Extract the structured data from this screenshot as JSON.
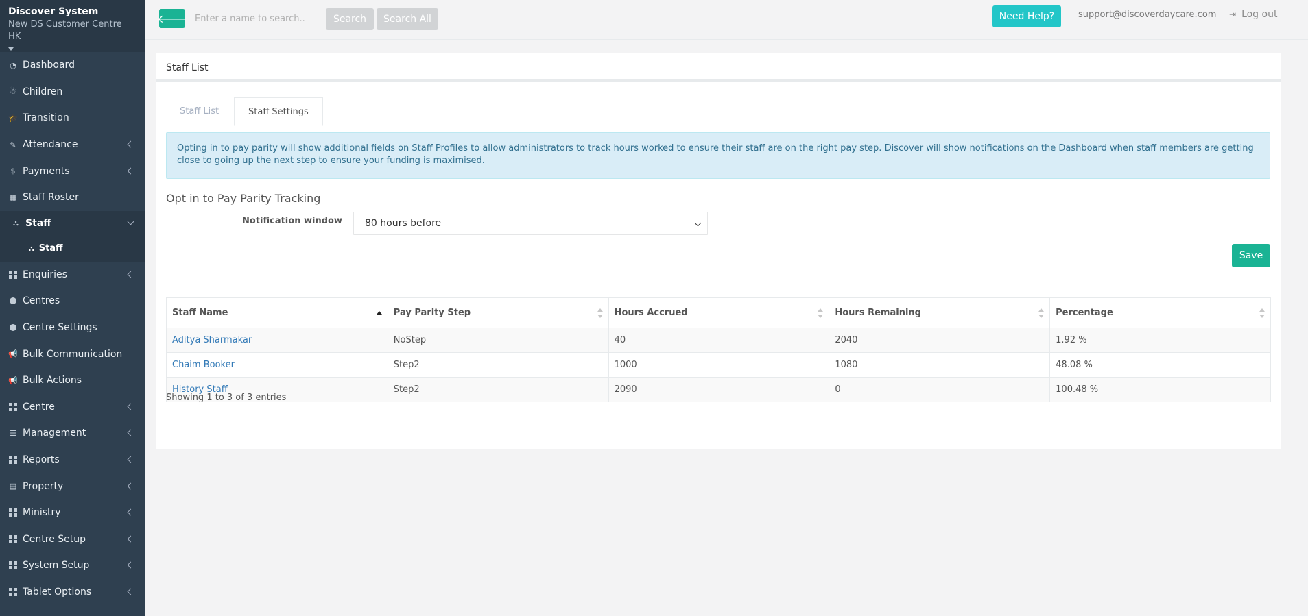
{
  "brand": {
    "title": "Discover System",
    "subtitle": "New DS Customer Centre HK"
  },
  "sidebar": {
    "items": [
      {
        "label": "Dashboard",
        "icon": "pie-chart-icon"
      },
      {
        "label": "Children",
        "icon": "child-icon"
      },
      {
        "label": "Transition",
        "icon": "graduation-cap-icon"
      },
      {
        "label": "Attendance",
        "icon": "edit-icon",
        "has_arrow": true
      },
      {
        "label": "Payments",
        "icon": "dollar-icon",
        "has_arrow": true
      },
      {
        "label": "Staff Roster",
        "icon": "calendar-icon"
      },
      {
        "label": "Staff",
        "icon": "sitemap-icon",
        "active": true
      },
      {
        "label": "Enquiries",
        "icon": "grid-icon",
        "has_arrow": true
      },
      {
        "label": "Centres",
        "icon": "circle-icon"
      },
      {
        "label": "Centre Settings",
        "icon": "circle-icon"
      },
      {
        "label": "Bulk Communication",
        "icon": "bullhorn-icon"
      },
      {
        "label": "Bulk Actions",
        "icon": "bullhorn-icon"
      },
      {
        "label": "Centre",
        "icon": "grid-icon",
        "has_arrow": true
      },
      {
        "label": "Management",
        "icon": "list-icon",
        "has_arrow": true
      },
      {
        "label": "Reports",
        "icon": "grid-icon",
        "has_arrow": true
      },
      {
        "label": "Property",
        "icon": "building-icon",
        "has_arrow": true
      },
      {
        "label": "Ministry",
        "icon": "grid-icon",
        "has_arrow": true
      },
      {
        "label": "Centre Setup",
        "icon": "grid-icon",
        "has_arrow": true
      },
      {
        "label": "System Setup",
        "icon": "grid-icon",
        "has_arrow": true
      },
      {
        "label": "Tablet Options",
        "icon": "grid-icon",
        "has_arrow": true
      }
    ],
    "sub_item": {
      "label": "Staff",
      "icon": "sitemap-icon"
    }
  },
  "topbar": {
    "search_placeholder": "Enter a name to search..",
    "search_label": "Search",
    "search_all_label": "Search All",
    "help_label": "Need Help?",
    "email": "support@discoverdaycare.com",
    "logout_label": "Log out"
  },
  "main": {
    "header": "Staff List",
    "tabs": [
      {
        "label": "Staff List",
        "active": false
      },
      {
        "label": "Staff Settings",
        "active": true
      }
    ],
    "alert": "Opting in to pay parity will show additional fields on Staff Profiles to allow administrators to track hours worked to ensure their staff are on the right pay step. Discover will show notifications on the Dashboard when staff members are getting close to going up the next step to ensure your funding is maximised.",
    "section_title": "Opt in to Pay Parity Tracking",
    "notification_label": "Notification window",
    "notification_value": "80 hours before",
    "save_label": "Save",
    "table": {
      "columns": [
        "Staff Name",
        "Pay Parity Step",
        "Hours Accrued",
        "Hours Remaining",
        "Percentage"
      ],
      "rows": [
        [
          "Aditya Sharmakar",
          "NoStep",
          "40",
          "2040",
          "1.92 %"
        ],
        [
          "Chaim Booker",
          "Step2",
          "1000",
          "1080",
          "48.08 %"
        ],
        [
          "History Staff",
          "Step2",
          "2090",
          "0",
          "100.48 %"
        ]
      ]
    },
    "info": "Showing 1 to 3 of 3 entries"
  },
  "colors": {
    "primary": "#1ab394",
    "info": "#23c6c8",
    "sidebar": "#2f4050",
    "link": "#337ab7"
  }
}
